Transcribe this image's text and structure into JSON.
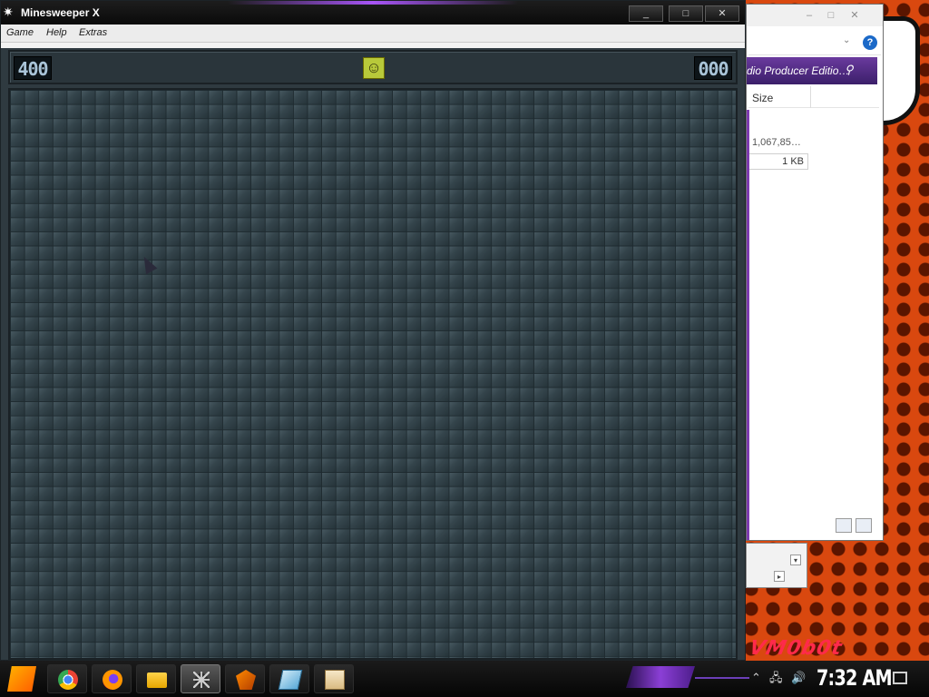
{
  "minesweeper": {
    "title": "Minesweeper X",
    "menu": [
      "Game",
      "Help",
      "Extras"
    ],
    "window_controls": [
      "_",
      "□",
      "✕"
    ],
    "mine_counter": "400",
    "timer": "000",
    "face": "☺"
  },
  "explorer": {
    "window_controls": [
      "–",
      "□",
      "✕"
    ],
    "search_text": "dio Producer Editio…",
    "column_size": "Size",
    "rows": [
      "1,067,85…",
      "1 KB"
    ],
    "help_icon": "?"
  },
  "taskbar": {
    "clock": "7:32 AM",
    "apps": [
      "start-icon",
      "chrome-icon",
      "firefox-icon",
      "folder-icon",
      "minesweeper-icon",
      "flstudio-icon",
      "crystal-icon",
      "notes-icon"
    ]
  },
  "wallpaper": {
    "text": "VM0b0t"
  },
  "colors": {
    "wallpaper": "#d9480f",
    "board": "#34444b",
    "accent_purple": "#8b3fd6"
  }
}
